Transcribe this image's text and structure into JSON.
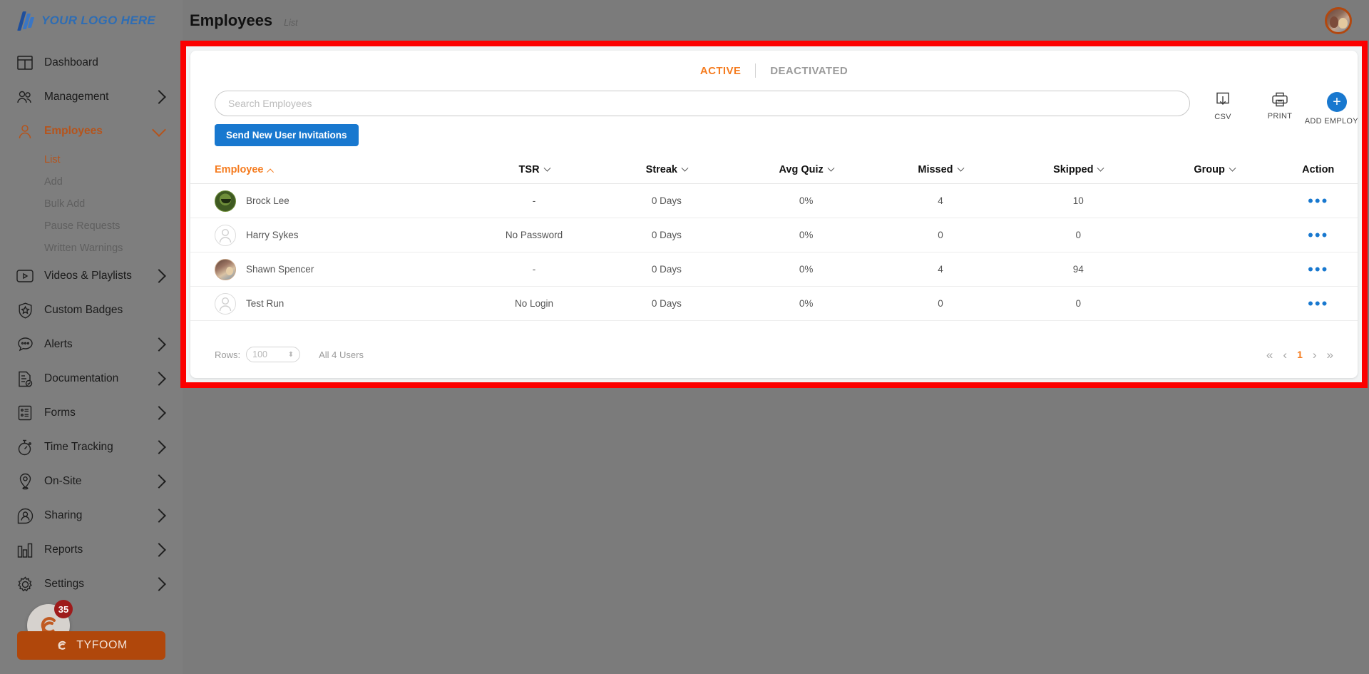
{
  "brand": {
    "logo_text": "YOUR LOGO HERE",
    "accent_orange": "#b5541c",
    "accent_blue": "#1878cf",
    "tab_orange": "#f57c20",
    "highlight_red": "#fc0000"
  },
  "sidebar": {
    "items": [
      {
        "label": "Dashboard",
        "icon": "dashboard-icon",
        "chevron": "none",
        "state": "normal"
      },
      {
        "label": "Management",
        "icon": "people-icon",
        "chevron": "right",
        "state": "normal"
      },
      {
        "label": "Employees",
        "icon": "person-icon",
        "chevron": "down",
        "state": "active"
      },
      {
        "label": "Videos & Playlists",
        "icon": "video-icon",
        "chevron": "right",
        "state": "normal"
      },
      {
        "label": "Custom Badges",
        "icon": "badge-shield-icon",
        "chevron": "none",
        "state": "normal"
      },
      {
        "label": "Alerts",
        "icon": "alert-chat-icon",
        "chevron": "right",
        "state": "normal"
      },
      {
        "label": "Documentation",
        "icon": "document-check-icon",
        "chevron": "right",
        "state": "normal"
      },
      {
        "label": "Forms",
        "icon": "forms-list-icon",
        "chevron": "right",
        "state": "normal"
      },
      {
        "label": "Time Tracking",
        "icon": "stopwatch-icon",
        "chevron": "right",
        "state": "normal"
      },
      {
        "label": "On-Site",
        "icon": "map-pin-icon",
        "chevron": "right",
        "state": "normal"
      },
      {
        "label": "Sharing",
        "icon": "share-person-icon",
        "chevron": "right",
        "state": "normal"
      },
      {
        "label": "Reports",
        "icon": "bar-chart-icon",
        "chevron": "right",
        "state": "normal"
      },
      {
        "label": "Settings",
        "icon": "gear-icon",
        "chevron": "right",
        "state": "normal"
      }
    ],
    "employees_subitems": [
      {
        "label": "List",
        "selected": true
      },
      {
        "label": "Add",
        "selected": false
      },
      {
        "label": "Bulk Add",
        "selected": false
      },
      {
        "label": "Pause Requests",
        "selected": false
      },
      {
        "label": "Written Warnings",
        "selected": false
      }
    ],
    "tyfoom": {
      "label": "TYFOOM",
      "badge_count": "35"
    }
  },
  "topbar": {
    "title": "Employees",
    "breadcrumb": "List",
    "avatar": "user-avatar"
  },
  "main": {
    "tabs": [
      {
        "label": "ACTIVE",
        "active": true
      },
      {
        "label": "DEACTIVATED",
        "active": false
      }
    ],
    "search": {
      "placeholder": "Search Employees",
      "value": ""
    },
    "invite_button": "Send New User Invitations",
    "actions": [
      {
        "label": "CSV",
        "icon": "download-csv-icon"
      },
      {
        "label": "PRINT",
        "icon": "printer-icon"
      },
      {
        "label": "ADD EMPLOYEE",
        "icon": "plus-circle-icon"
      }
    ],
    "table": {
      "columns": [
        {
          "label": "Employee",
          "sort": "asc",
          "align": "left"
        },
        {
          "label": "TSR",
          "sort": "desc",
          "align": "center"
        },
        {
          "label": "Streak",
          "sort": "desc",
          "align": "center"
        },
        {
          "label": "Avg Quiz",
          "sort": "desc",
          "align": "center"
        },
        {
          "label": "Missed",
          "sort": "desc",
          "align": "center"
        },
        {
          "label": "Skipped",
          "sort": "desc",
          "align": "center"
        },
        {
          "label": "Group",
          "sort": "desc",
          "align": "center"
        },
        {
          "label": "Action",
          "sort": "none",
          "align": "center"
        }
      ],
      "rows": [
        {
          "avatar": "brock",
          "name": "Brock Lee",
          "tsr": "-",
          "streak": "0 Days",
          "avg_quiz": "0%",
          "missed": "4",
          "skipped": "10",
          "group": "",
          "action": "•••"
        },
        {
          "avatar": "blank",
          "name": "Harry Sykes",
          "tsr": "No Password",
          "streak": "0 Days",
          "avg_quiz": "0%",
          "missed": "0",
          "skipped": "0",
          "group": "",
          "action": "•••"
        },
        {
          "avatar": "shawn",
          "name": "Shawn Spencer",
          "tsr": "-",
          "streak": "0 Days",
          "avg_quiz": "0%",
          "missed": "4",
          "skipped": "94",
          "group": "",
          "action": "•••"
        },
        {
          "avatar": "blank",
          "name": "Test Run",
          "tsr": "No Login",
          "streak": "0 Days",
          "avg_quiz": "0%",
          "missed": "0",
          "skipped": "0",
          "group": "",
          "action": "•••"
        }
      ]
    },
    "footer": {
      "rows_label": "Rows:",
      "rows_value": "100",
      "total_label": "All 4 Users",
      "pagination": {
        "first": "«",
        "prev": "‹",
        "current": "1",
        "next": "›",
        "last": "»"
      }
    }
  }
}
